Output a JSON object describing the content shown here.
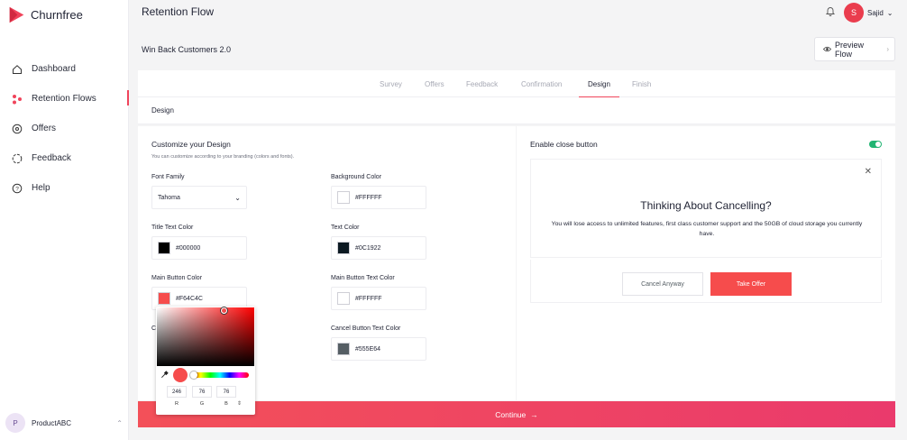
{
  "brand": {
    "name": "Churnfree",
    "accent": "#f0445b"
  },
  "sidebar": {
    "items": [
      {
        "label": "Dashboard",
        "icon": "home-icon"
      },
      {
        "label": "Retention Flows",
        "icon": "flows-icon"
      },
      {
        "label": "Offers",
        "icon": "tag-icon"
      },
      {
        "label": "Feedback",
        "icon": "chat-icon"
      },
      {
        "label": "Help",
        "icon": "help-icon"
      }
    ],
    "workspace": {
      "initial": "P",
      "name": "ProductABC"
    }
  },
  "header": {
    "title": "Retention Flow",
    "user_initial": "S",
    "user_name": "Sajid"
  },
  "flow": {
    "name": "Win Back Customers 2.0",
    "preview_label": "Preview Flow"
  },
  "tabs": [
    "Survey",
    "Offers",
    "Feedback",
    "Confirmation",
    "Design",
    "Finish"
  ],
  "active_tab": "Design",
  "section_title": "Design",
  "customize": {
    "title": "Customize your Design",
    "subtitle": "You can customize according to your branding (colors and fonts).",
    "font_family": {
      "label": "Font Family",
      "value": "Tahoma"
    },
    "background_color": {
      "label": "Background Color",
      "value": "#FFFFFF"
    },
    "title_text_color": {
      "label": "Title Text Color",
      "value": "#000000"
    },
    "text_color": {
      "label": "Text Color",
      "value": "#0C1922"
    },
    "main_button_color": {
      "label": "Main Button Color",
      "value": "#F64C4C"
    },
    "main_button_text_color": {
      "label": "Main Button Text Color",
      "value": "#FFFFFF"
    },
    "cancel_button_text_color": {
      "label": "Cancel Button Text Color",
      "value": "#555E64"
    },
    "hidden_label_fragment": "C"
  },
  "picker": {
    "r": "246",
    "g": "76",
    "b": "76",
    "r_label": "R",
    "g_label": "G",
    "b_label": "B"
  },
  "preview": {
    "close_button_label": "Enable close button",
    "close_enabled": true,
    "title": "Thinking About Cancelling?",
    "body": "You will lose access to unlimited features, first class customer support and the 50GB of cloud storage you currently have.",
    "cancel_label": "Cancel Anyway",
    "offer_label": "Take Offer"
  },
  "continue_label": "Continue"
}
